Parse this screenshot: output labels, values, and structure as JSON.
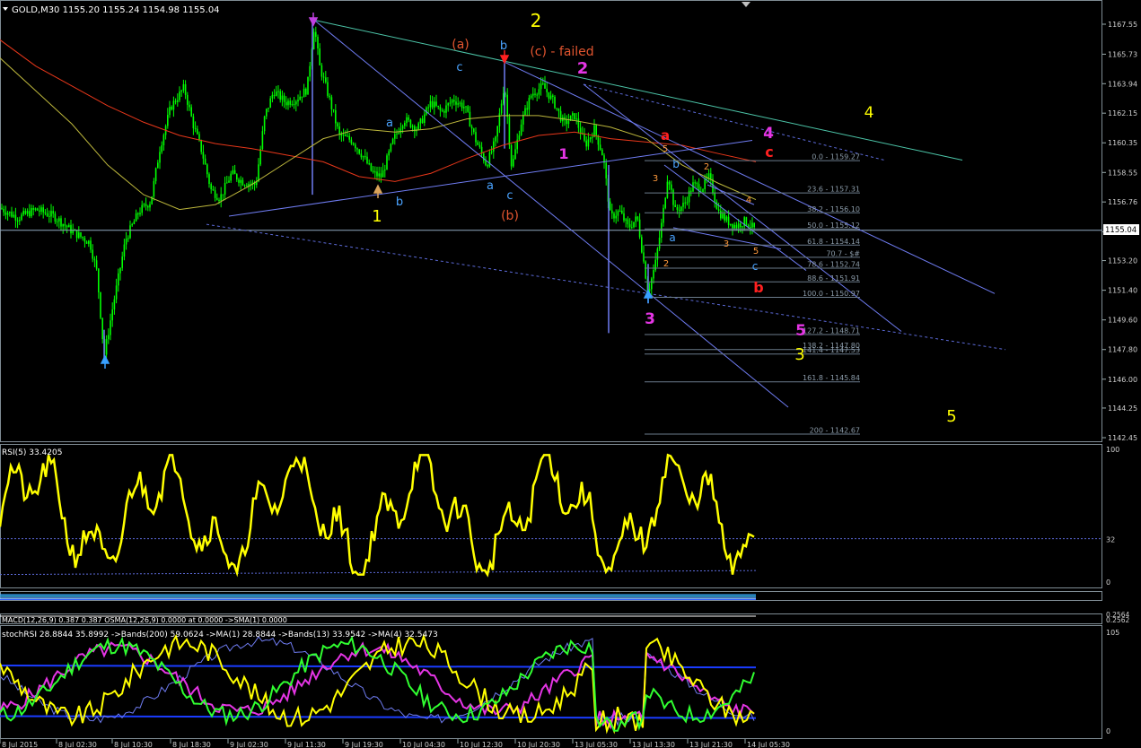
{
  "chart_data": {
    "type": "candlestick",
    "symbol_header": "GOLD,M30  1155.20 1155.24 1154.98 1155.04",
    "timeframe": "M30",
    "ohlc": {
      "open": 1155.2,
      "high": 1155.24,
      "low": 1154.98,
      "close": 1155.04
    },
    "current_price": "1155.04",
    "ylim": [
      1141.6,
      1169.3
    ],
    "y_ticks": [
      "1167.55",
      "1165.73",
      "1163.94",
      "1162.15",
      "1160.35",
      "1158.55",
      "1156.76",
      "1154.95",
      "1153.20",
      "1151.40",
      "1149.60",
      "1147.80",
      "1146.00",
      "1144.25",
      "1142.45"
    ],
    "x_ticks": [
      "8 Jul 2015",
      "8 Jul 02:30",
      "8 Jul 10:30",
      "8 Jul 18:30",
      "9 Jul 02:30",
      "9 Jul 11:30",
      "9 Jul 19:30",
      "10 Jul 04:30",
      "10 Jul 12:30",
      "10 Jul 20:30",
      "13 Jul 05:30",
      "13 Jul 13:30",
      "13 Jul 21:30",
      "14 Jul 05:30"
    ],
    "fib_levels": [
      {
        "label": "0.0 - 1159.27",
        "value": 1159.27
      },
      {
        "label": "23.6 - 1157.31",
        "value": 1157.31
      },
      {
        "label": "38.2 - 1156.10",
        "value": 1156.1
      },
      {
        "label": "50.0 - 1155.12",
        "value": 1155.12
      },
      {
        "label": "61.8 - 1154.14",
        "value": 1154.14
      },
      {
        "label": "70.7 - $#",
        "value": 1153.4
      },
      {
        "label": "78.6 - 1152.74",
        "value": 1152.74
      },
      {
        "label": "88.6 - 1151.91",
        "value": 1151.91
      },
      {
        "label": "100.0 - 1150.97",
        "value": 1150.97
      },
      {
        "label": "127.2 - 1148.71",
        "value": 1148.71
      },
      {
        "label": "138.2 - 1147.80",
        "value": 1147.8
      },
      {
        "label": "141.4 - 1147.53",
        "value": 1147.53
      },
      {
        "label": "161.8 - 1145.84",
        "value": 1145.84
      },
      {
        "label": "200 - 1142.67",
        "value": 1142.67
      }
    ],
    "wave_labels": [
      {
        "text": "2",
        "color": "#ffff00"
      },
      {
        "text": "(a)",
        "color": "#e2552f"
      },
      {
        "text": "b",
        "color": "#4aa3ff"
      },
      {
        "text": "(c) - failed",
        "color": "#e2552f"
      },
      {
        "text": "c",
        "color": "#4aa3ff"
      },
      {
        "text": "2",
        "color": "#e535e5"
      },
      {
        "text": "4",
        "color": "#ffff00"
      },
      {
        "text": "4",
        "color": "#e535e5"
      },
      {
        "text": "c",
        "color": "#ff2020"
      },
      {
        "text": "a",
        "color": "#ff2020"
      },
      {
        "text": "a",
        "color": "#4aa3ff"
      },
      {
        "text": "1",
        "color": "#e535e5"
      },
      {
        "text": "a",
        "color": "#4aa3ff"
      },
      {
        "text": "c",
        "color": "#4aa3ff"
      },
      {
        "text": "b",
        "color": "#4aa3ff"
      },
      {
        "text": "1",
        "color": "#ffff00"
      },
      {
        "text": "(b)",
        "color": "#e2552f"
      },
      {
        "text": "3",
        "color": "#e535e5"
      },
      {
        "text": "5",
        "color": "#e535e5"
      },
      {
        "text": "3",
        "color": "#ffff00"
      },
      {
        "text": "5",
        "color": "#ffff00"
      },
      {
        "text": "b",
        "color": "#ff2020"
      },
      {
        "text": "5",
        "color": "#ff9a3c"
      },
      {
        "text": "3",
        "color": "#ff9a3c"
      },
      {
        "text": "2",
        "color": "#ff9a3c"
      },
      {
        "text": "4",
        "color": "#ff9a3c"
      },
      {
        "text": "b",
        "color": "#4aa3ff"
      },
      {
        "text": "a",
        "color": "#4aa3ff"
      },
      {
        "text": "c",
        "color": "#4aa3ff"
      },
      {
        "text": "2",
        "color": "#ff9a3c"
      },
      {
        "text": "3",
        "color": "#ff9a3c"
      },
      {
        "text": "5",
        "color": "#ff9a3c"
      }
    ]
  },
  "rsi_panel": {
    "header": "RSI(5) 33.4205",
    "ticks": [
      "100",
      "32",
      "0"
    ],
    "current": 33.4205
  },
  "macd_panel": {
    "header": "MACD(12,26,9) 0.387 0.387 OSMA(12,26,9) 0.0000 at 0.0000 ->SMA(1) 0.0000",
    "ticks": [
      "0.2564",
      "0.2562"
    ]
  },
  "stoch_panel": {
    "header": "stochRSI 28.8844 35.8992  ->Bands(200) 59.0624  ->MA(1) 28.8844  ->Bands(13) 33.9542  ->MA(4) 32.5473",
    "ticks": [
      "105",
      "0"
    ]
  },
  "colors": {
    "bull": "#00ff00",
    "bear": "#00ff00",
    "grid": "#6b7b8b",
    "rsi_line": "#ffff00",
    "ma_red": "#e8371a",
    "ma_yellow": "#bdb73c",
    "trend_blue": "#6f7cf2",
    "trend_green": "#4cc5a8"
  }
}
